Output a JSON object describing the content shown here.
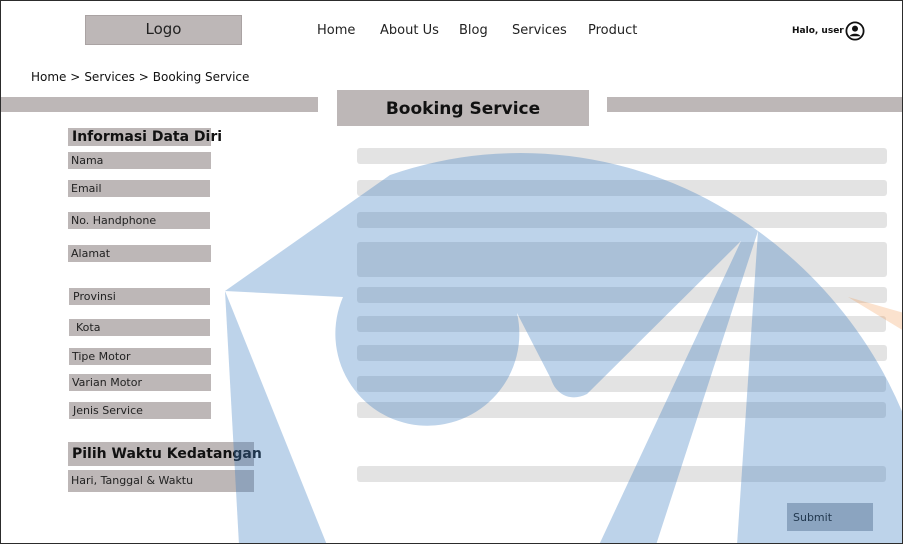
{
  "header": {
    "logo_text": "Logo",
    "nav": [
      "Home",
      "About Us",
      "Blog",
      "Services",
      "Product"
    ],
    "user_greeting": "Halo, user"
  },
  "breadcrumb": [
    "Home >",
    "Services >",
    "Booking Service"
  ],
  "page_title": "Booking Service",
  "sections": {
    "personal": {
      "heading": "Informasi Data Diri",
      "fields": [
        "Nama",
        "Email",
        "No. Handphone",
        "Alamat",
        "Provinsi",
        "Kota",
        "Tipe Motor",
        "Varian Motor",
        "Jenis Service"
      ]
    },
    "schedule": {
      "heading": "Pilih Waktu Kedatangan",
      "fields": [
        "Hari, Tanggal & Waktu"
      ]
    }
  },
  "submit_label": "Submit",
  "colors": {
    "label_bg": "#bdb7b7",
    "input_bg": "#e3e3e3",
    "watermark_blue": "#3d7fc0",
    "watermark_orange": "#f08a3c"
  }
}
